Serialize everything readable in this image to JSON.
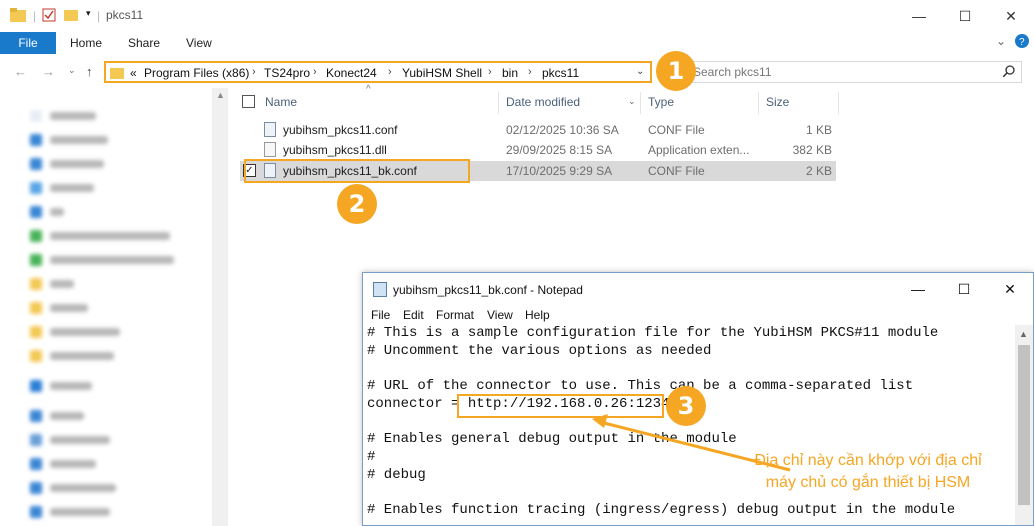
{
  "explorer": {
    "title": "pkcs11",
    "window_controls": [
      "—",
      "☐",
      "✕"
    ],
    "ribbon_tabs": {
      "file": "File",
      "home": "Home",
      "share": "Share",
      "view": "View"
    },
    "address": {
      "overflow": "«",
      "crumbs": [
        "Program Files (x86)",
        "TS24pro",
        "Konect24",
        "YubiHSM Shell",
        "bin",
        "pkcs11"
      ],
      "separator": "›"
    },
    "search_placeholder": "Search pkcs11",
    "columns": {
      "name": "Name",
      "date": "Date modified",
      "type": "Type",
      "size": "Size"
    },
    "files": [
      {
        "name": "yubihsm_pkcs11.conf",
        "date": "02/12/2025 10:36 SA",
        "type": "CONF File",
        "size": "1 KB",
        "icon": "conf-file-icon"
      },
      {
        "name": "yubihsm_pkcs11.dll",
        "date": "29/09/2025 8:15 SA",
        "type": "Application exten...",
        "size": "382 KB",
        "icon": "dll-file-icon"
      },
      {
        "name": "yubihsm_pkcs11_bk.conf",
        "date": "17/10/2025 9:29 SA",
        "type": "CONF File",
        "size": "2 KB",
        "icon": "conf-file-icon",
        "selected": true,
        "checked": "✓"
      }
    ]
  },
  "notepad": {
    "title": "yubihsm_pkcs11_bk.conf - Notepad",
    "window_controls": [
      "—",
      "☐",
      "✕"
    ],
    "menu": {
      "file": "File",
      "edit": "Edit",
      "format": "Format",
      "view": "View",
      "help": "Help"
    },
    "lines": [
      "# This is a sample configuration file for the YubiHSM PKCS#11 module",
      "# Uncomment the various options as needed",
      "",
      "# URL of the connector to use. This can be a comma-separated list",
      "connector = http://192.168.0.26:12345",
      "",
      "# Enables general debug output in the module",
      "#",
      "# debug",
      "",
      "# Enables function tracing (ingress/egress) debug output in the module"
    ]
  },
  "annotations": {
    "badge_1": "1",
    "badge_2": "2",
    "badge_3": "3",
    "note_line1": "Địa chỉ này cần khớp với địa chỉ",
    "note_line2": "máy chủ có gắn thiết bị HSM",
    "accent_color": "#f5a623"
  }
}
